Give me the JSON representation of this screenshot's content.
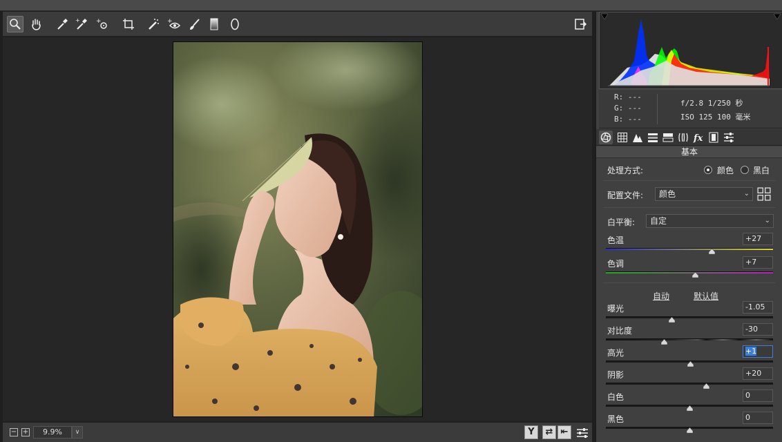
{
  "toolbar": {
    "tools": [
      "zoom-tool",
      "hand-tool",
      "white-balance-tool",
      "color-sampler-tool",
      "targeted-adjustment-tool",
      "crop-tool",
      "spot-removal-tool",
      "red-eye-tool",
      "adjustment-brush-tool",
      "graduated-filter-tool",
      "radial-filter-tool"
    ],
    "active_tool": "zoom-tool",
    "open_prefs_icon": "export-icon"
  },
  "status": {
    "zoom_out": "−",
    "zoom_in": "+",
    "zoom_value": "9.9%",
    "zoom_dropdown": "∨",
    "view_buttons": [
      "Y",
      "⇄",
      "⇤"
    ]
  },
  "info": {
    "r": "R:   ---",
    "g": "G:   ---",
    "b": "B:   ---",
    "exif_line1": "f/2.8  1/250 秒",
    "exif_line2": "ISO 125  100 毫米"
  },
  "panel": {
    "title": "基本",
    "treatment_label": "处理方式:",
    "treatment_options": [
      "颜色",
      "黑白"
    ],
    "treatment_selected": "颜色",
    "profile_label": "配置文件:",
    "profile_value": "颜色",
    "wb_label": "白平衡:",
    "wb_value": "自定",
    "auto_link": "自动",
    "default_link": "默认值",
    "sliders": [
      {
        "label": "色温",
        "value": "+27",
        "position": 0.633
      },
      {
        "label": "色调",
        "value": "+7",
        "position": 0.535
      },
      {
        "label": "曝光",
        "value": "-1.05",
        "position": 0.395
      },
      {
        "label": "对比度",
        "value": "-30",
        "position": 0.35
      },
      {
        "label": "高光",
        "value": "+1",
        "position": 0.505
      },
      {
        "label": "阴影",
        "value": "+20",
        "position": 0.6
      },
      {
        "label": "白色",
        "value": "0",
        "position": 0.5
      },
      {
        "label": "黑色",
        "value": "0",
        "position": 0.5
      }
    ]
  },
  "colors": {
    "temp_gradient": [
      "#2a2ac8",
      "#d8d820"
    ],
    "tint_gradient": [
      "#20b020",
      "#c020c0"
    ],
    "selection": "#3d7fd6"
  }
}
